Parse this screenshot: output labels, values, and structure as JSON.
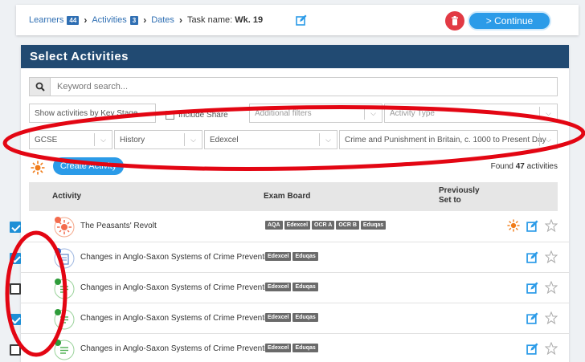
{
  "breadcrumb": {
    "items": [
      {
        "label": "Learners",
        "badge": "44"
      },
      {
        "label": "Activities",
        "badge": "3"
      },
      {
        "label": "Dates",
        "badge": null
      }
    ],
    "task_prefix": "Task name:",
    "task_value": "Wk. 19"
  },
  "toolbar": {
    "continue_label": "> Continue"
  },
  "panel": {
    "title": "Select Activities"
  },
  "search": {
    "placeholder": "Keyword search..."
  },
  "filters": {
    "show_by": "Show activities by Key Stage",
    "include_share": "Include Share",
    "additional_placeholder": "Additional filters",
    "activity_type_placeholder": "Activity Type",
    "qualification": "GCSE",
    "subject": "History",
    "exam_board": "Edexcel",
    "topic": "Crime and Punishment in Britain, c. 1000 to Present Day"
  },
  "create_label": "Create Activity",
  "found": {
    "prefix": "Found",
    "count": "47",
    "suffix": "activities"
  },
  "table": {
    "headers": {
      "activity": "Activity",
      "exam_board": "Exam Board",
      "previously_line1": "Previously",
      "previously_line2": "Set to"
    },
    "rows": [
      {
        "title": "The Peasants' Revolt",
        "checked": true,
        "tags": [
          "AQA",
          "Edexcel",
          "OCR A",
          "OCR B",
          "Eduqas"
        ]
      },
      {
        "title": "Changes in Anglo-Saxon Systems of Crime Preventi...",
        "checked": true,
        "tags": [
          "Edexcel",
          "Eduqas"
        ]
      },
      {
        "title": "Changes in Anglo-Saxon Systems of Crime Preventi...",
        "checked": false,
        "tags": [
          "Edexcel",
          "Eduqas"
        ]
      },
      {
        "title": "Changes in Anglo-Saxon Systems of Crime Preventi...",
        "checked": true,
        "tags": [
          "Edexcel",
          "Eduqas"
        ]
      },
      {
        "title": "Changes in Anglo-Saxon Systems of Crime Preventi...",
        "checked": false,
        "tags": [
          "Edexcel",
          "Eduqas"
        ]
      }
    ]
  },
  "colors": {
    "header": "#214a72",
    "accent": "#2b9be8",
    "danger": "#e23a44",
    "annotation": "#e30613"
  }
}
